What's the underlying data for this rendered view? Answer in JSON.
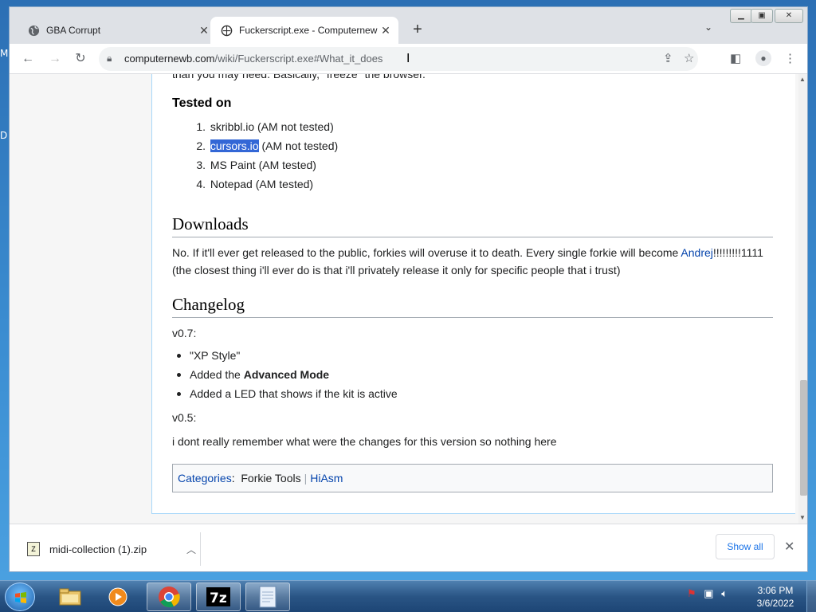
{
  "desktop": {
    "edge_label_1": "M",
    "edge_label_2": "D"
  },
  "browser": {
    "tabs": [
      {
        "title": "GBA Corrupt",
        "active": false
      },
      {
        "title": "Fuckerscript.exe - Computernewb",
        "active": true
      }
    ],
    "new_tab": "+",
    "url_host": "computernewb.com",
    "url_path": "/wiki/Fuckerscript.exe#What_it_does"
  },
  "article": {
    "cut_text": "than you may need. Basically, \"freeze\" the browser.",
    "tested_heading": "Tested on",
    "tested_items": [
      {
        "num": "1.",
        "text": "skribbl.io (AM not tested)"
      },
      {
        "num": "2.",
        "selected": "cursors.io",
        "text": " (AM not tested)"
      },
      {
        "num": "3.",
        "text": "MS Paint (AM tested)"
      },
      {
        "num": "4.",
        "text": "Notepad (AM tested)"
      }
    ],
    "downloads_heading": "Downloads",
    "downloads_text_1": "No. If it'll ever get released to the public, forkies will overuse it to death. Every single forkie will become ",
    "downloads_link": "Andrej",
    "downloads_text_2": "!!!!!!!!!1111",
    "downloads_text_3": "(the closest thing i'll ever do is that i'll privately release it only for specific people that i trust)",
    "changelog_heading": "Changelog",
    "v07_label": "v0.7:",
    "v07_items": [
      "\"XP Style\"",
      "Added the ",
      "Added a LED that shows if the kit is active"
    ],
    "advanced_mode": "Advanced Mode",
    "v05_label": "v0.5:",
    "v05_text": "i dont really remember what were the changes for this version so nothing here",
    "categories_label": "Categories",
    "categories": [
      "Forkie Tools",
      "HiAsm"
    ]
  },
  "downloads_shelf": {
    "file_name": "midi-collection (1).zip",
    "show_all": "Show all"
  },
  "taskbar": {
    "time": "3:06 PM",
    "date": "3/6/2022",
    "apps": [
      "explorer-icon",
      "media-player-icon",
      "chrome-icon",
      "7zip-icon",
      "notepad-icon"
    ]
  }
}
